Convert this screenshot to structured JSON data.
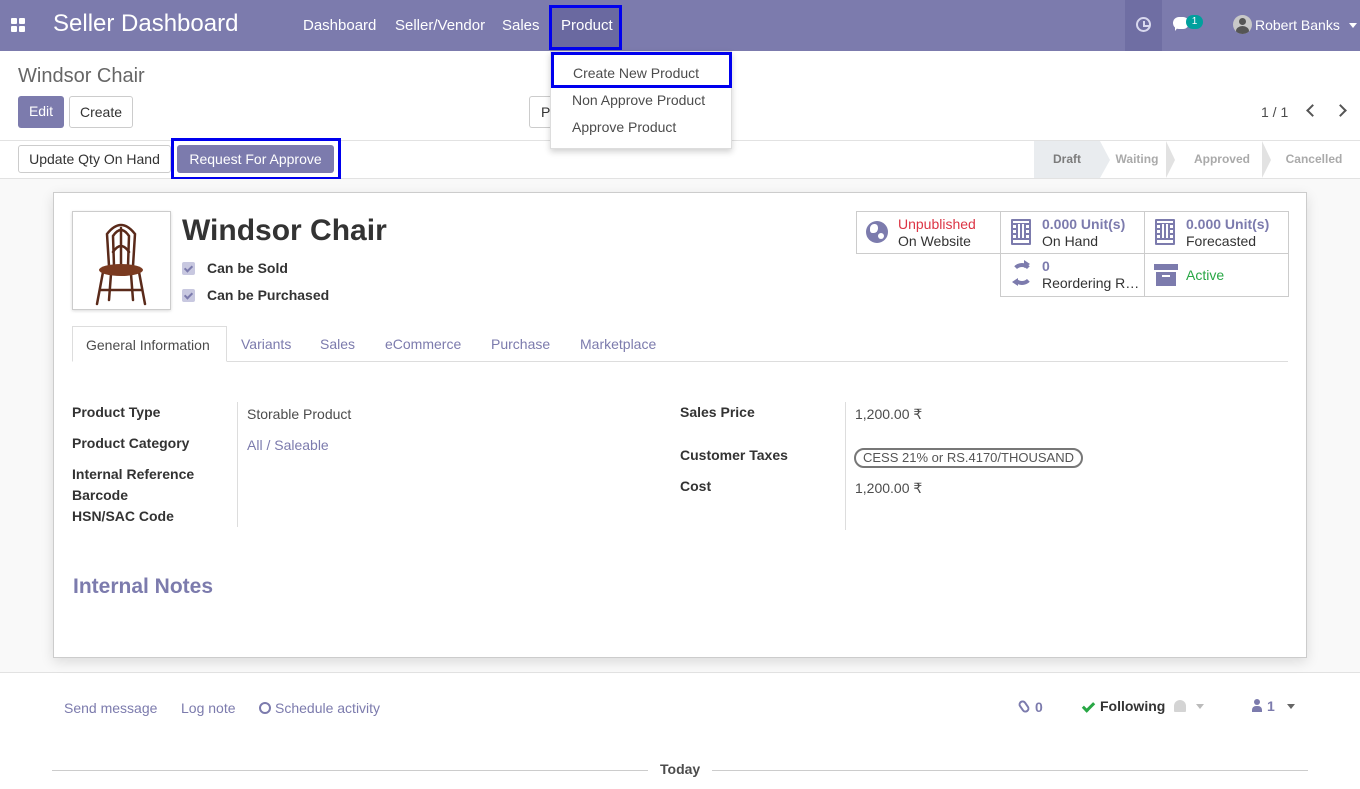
{
  "navbar": {
    "brand": "Seller Dashboard",
    "menu": [
      "Dashboard",
      "Seller/Vendor",
      "Sales"
    ],
    "active_menu": "Product",
    "chat_badge": "1",
    "user": "Robert Banks"
  },
  "product_menu": {
    "items": [
      "Create New Product",
      "Non Approve Product",
      "Approve Product"
    ]
  },
  "control_panel": {
    "breadcrumb": "Windsor Chair",
    "edit_label": "Edit",
    "create_label": "Create",
    "print_label": "P",
    "pager": "1 / 1"
  },
  "statusbar": {
    "update_qty_label": "Update Qty On Hand",
    "request_label": "Request For Approve",
    "stages": [
      "Draft",
      "Waiting",
      "Approved",
      "Cancelled"
    ],
    "active_stage": "Draft"
  },
  "product": {
    "name": "Windsor Chair",
    "can_be_sold": "Can be Sold",
    "can_be_purchased": "Can be Purchased"
  },
  "smart_buttons": {
    "website_status": "Unpublished",
    "website_label": "On Website",
    "on_hand_value": "0.000 Unit(s)",
    "on_hand_label": "On Hand",
    "forecast_value": "0.000 Unit(s)",
    "forecast_label": "Forecasted",
    "reorder_value": "0",
    "reorder_label": "Reordering R…",
    "active_label": "Active"
  },
  "tabs": [
    "General Information",
    "Variants",
    "Sales",
    "eCommerce",
    "Purchase",
    "Marketplace"
  ],
  "general_info": {
    "left_labels": [
      "Product Type",
      "Product Category",
      "Internal Reference",
      "Barcode",
      "HSN/SAC Code"
    ],
    "product_type": "Storable Product",
    "product_category": "All / Saleable",
    "sales_price_label": "Sales Price",
    "sales_price": "1,200.00 ₹",
    "customer_taxes_label": "Customer Taxes",
    "customer_tax_tag": "CESS 21% or RS.4170/THOUSAND",
    "cost_label": "Cost",
    "cost": "1,200.00 ₹"
  },
  "internal_notes_title": "Internal Notes",
  "chatter": {
    "send_message": "Send message",
    "log_note": "Log note",
    "schedule_activity": "Schedule activity",
    "attachments": "0",
    "following": "Following",
    "followers": "1",
    "today": "Today"
  },
  "colors": {
    "brand": "#7c7bad",
    "highlight_frame": "#0000ee",
    "unpublished": "#dc3545",
    "active": "#28a745"
  }
}
